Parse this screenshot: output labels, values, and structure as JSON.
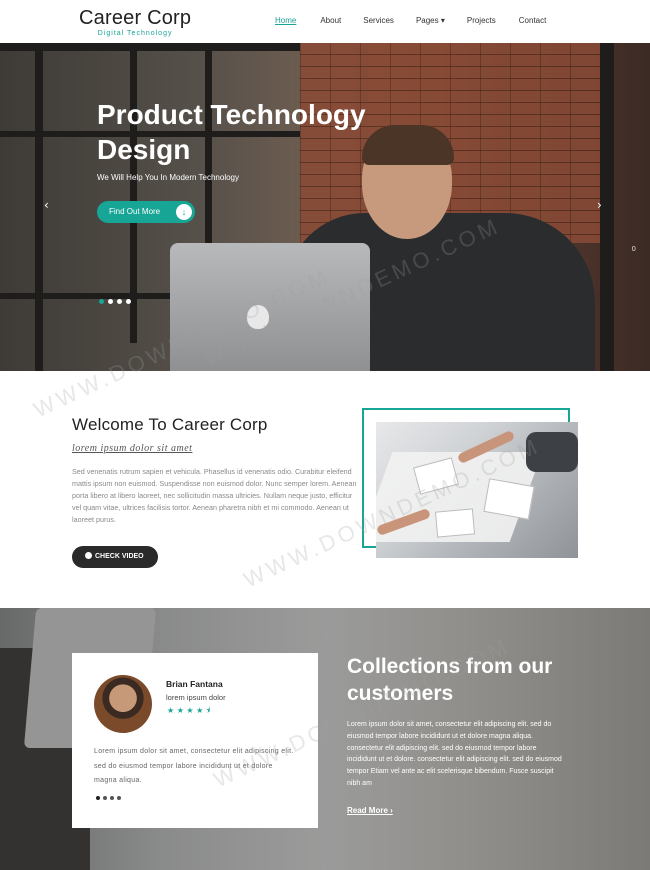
{
  "brand": {
    "name": "Career Corp",
    "tagline": "Digital Technology"
  },
  "nav": {
    "items": [
      {
        "label": "Home",
        "active": true
      },
      {
        "label": "About"
      },
      {
        "label": "Services"
      },
      {
        "label": "Pages ▾"
      },
      {
        "label": "Projects"
      },
      {
        "label": "Contact"
      }
    ]
  },
  "hero": {
    "title": "Product Technology Design",
    "subtitle": "We Will Help You In Modern Technology",
    "button_label": "Find Out More",
    "button_icon": "↓",
    "prev_icon": "‹",
    "next_icon": "›",
    "slide_counter": "0"
  },
  "welcome": {
    "title": "Welcome To Career Corp",
    "subtitle": "lorem ipsum dolor sit amet",
    "body": "Sed venenatis rutrum sapien et vehicula. Phasellus id venenatis odio. Curabitur eleifend mattis ipsum non euismod. Suspendisse non euismod dolor. Nunc semper lorem. Aenean porta libero at libero laoreet, nec sollicitudin massa ultricies. Nullam neque justo, efficitur vel quam vitae, ultrices facilisis tortor. Aenean pharetra nibh et mi commodo. Aenean ut laoreet purus.",
    "video_button": "CHECK VIDEO"
  },
  "testimonial": {
    "name": "Brian Fantana",
    "role": "lorem ipsum dolor",
    "rating": 4.5,
    "stars": "★ ★ ★ ★ ⯨",
    "body": "Lorem ipsum dolor sit amet, consectetur elit adipiscing elit. sed do eiusmod tempor labore incididunt ut et dolore magna aliqua."
  },
  "collections": {
    "title": "Collections from our customers",
    "body": "Lorem ipsum dolor sit amet, consectetur elit adipiscing elit. sed do eiusmod tempor labore incididunt ut et dolore magna aliqua. consectetur elit adipiscing elit. sed do eiusmod tempor labore incididunt ut et dolore. consectetur elit adipiscing elit. sed do eiusmod tempor Etiam vel ante ac elit scelerisque bibendum. Fusce suscipit nibh am",
    "link_label": "Read More ›"
  },
  "colors": {
    "accent": "#17a596",
    "dark": "#2a2a2a"
  },
  "watermark": "WWW.DOWNDEMO.COM"
}
